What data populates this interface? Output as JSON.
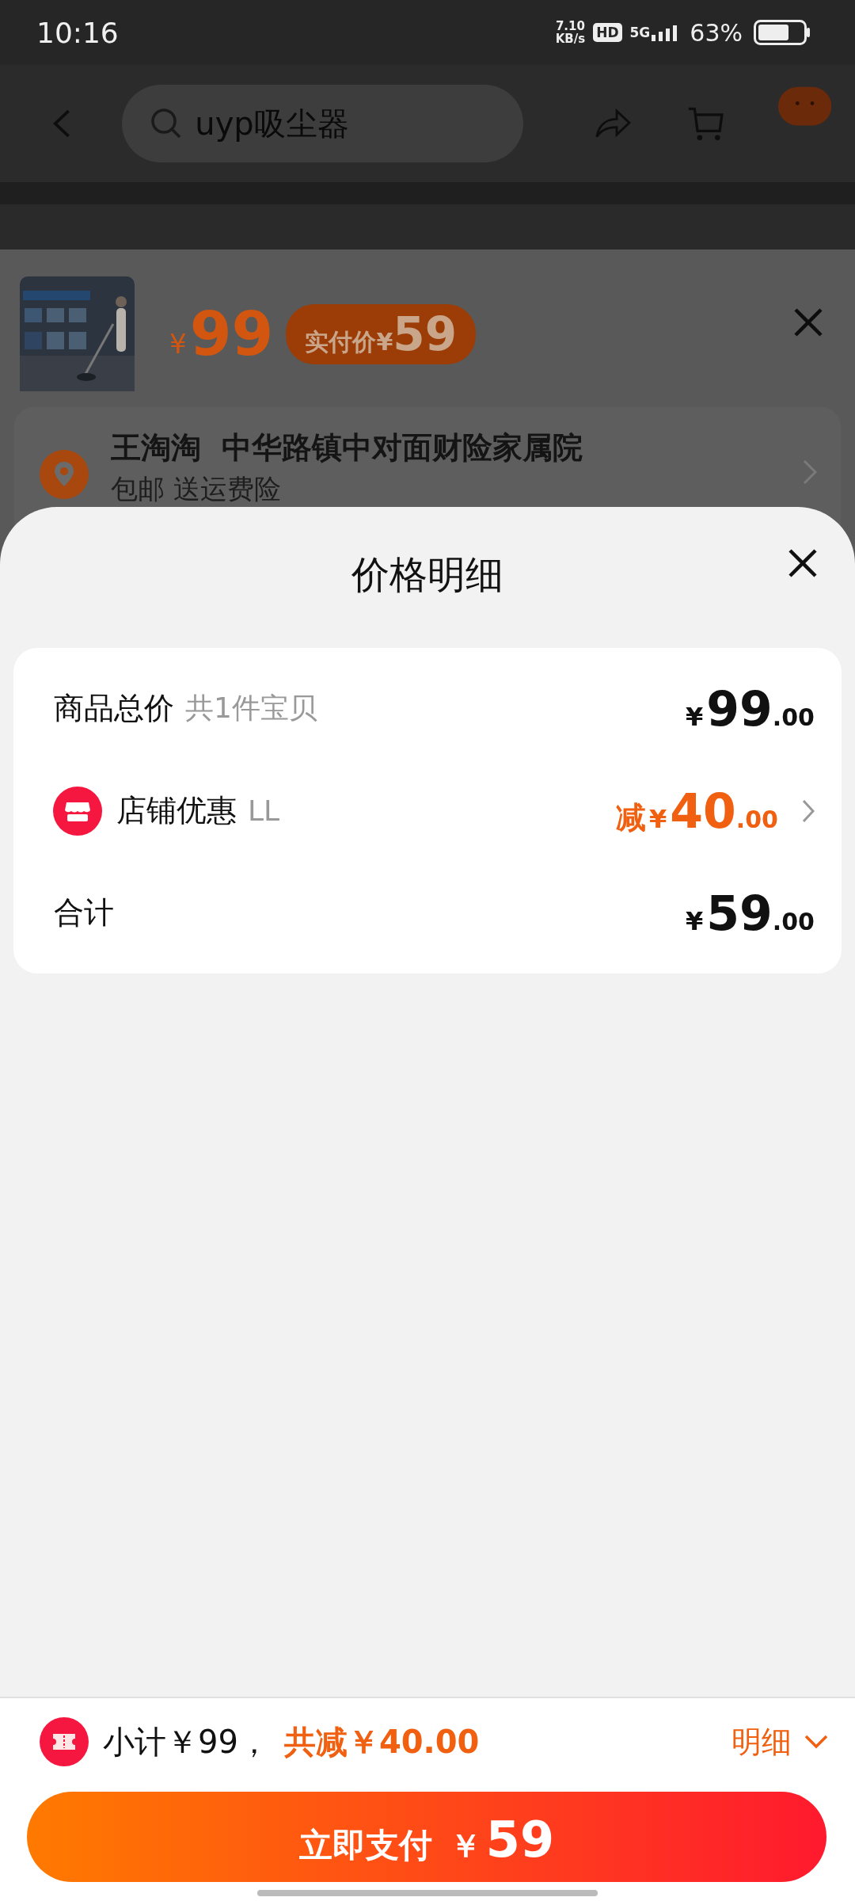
{
  "status_bar": {
    "time": "10:16",
    "speed": "7.10",
    "speed_unit": "KB/s",
    "hd": "HD",
    "network": "5G",
    "battery": "63%"
  },
  "top_nav": {
    "search": {
      "placeholder": "uyp吸尘器"
    }
  },
  "product": {
    "price_symbol": "¥",
    "price": "99",
    "pay_label": "实付价",
    "pay_symbol": "¥",
    "pay_amount": "59"
  },
  "address": {
    "name": "王淘淘",
    "address": "中华路镇中对面财险家属院",
    "shipping": "包邮  送运费险"
  },
  "sheet": {
    "title": "价格明细",
    "rows": [
      {
        "kind": "total",
        "label": "商品总价",
        "note": "共1件宝贝",
        "prefix": "",
        "symbol": "¥",
        "amount": "99",
        "decimals": ".00"
      },
      {
        "kind": "discount",
        "label": "店铺优惠",
        "note": "LL",
        "prefix": "减",
        "symbol": "¥",
        "amount": "40",
        "decimals": ".00"
      },
      {
        "kind": "sum",
        "label": "合计",
        "note": "",
        "prefix": "",
        "symbol": "¥",
        "amount": "59",
        "decimals": ".00"
      }
    ]
  },
  "footer": {
    "subtotal": "小计￥99，",
    "discount": "共减￥40.00",
    "details": "明细",
    "pay_label": "立即支付",
    "pay_symbol": "￥",
    "pay_amount": "59"
  }
}
